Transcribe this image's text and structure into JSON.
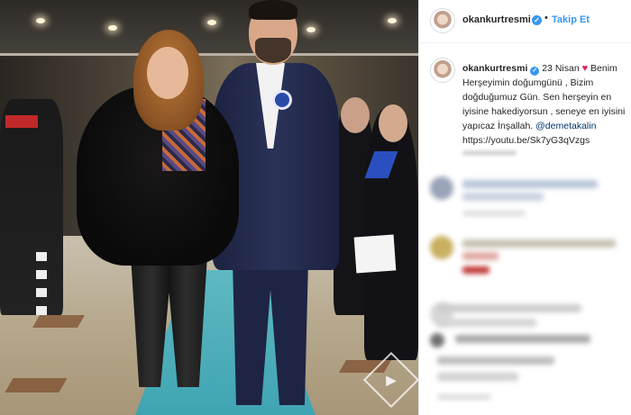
{
  "post": {
    "username": "okankurtresmi",
    "verified_glyph": "✓",
    "separator": "•",
    "follow_label": "Takip Et",
    "caption": {
      "username": "okankurtresmi",
      "date": "23 Nisan",
      "heart": "♥",
      "text_part1": "Benim Herşeyimin doğumgünü , Bizim doğduğumuz Gün. Sen herşeyin en iyisine hakediyorsun , seneye en iyisini yapıcaz İnşallah.",
      "mention": "@demetakalin",
      "link": "https://youtu.be/Sk7yG3qVzgs"
    }
  },
  "icons": {
    "verified": "verified-badge-icon",
    "heart": "heart-icon",
    "watermark": "watermark-logo-icon"
  },
  "colors": {
    "link_blue": "#3897f0",
    "mention_blue": "#003569",
    "heart_red": "#e0245e"
  }
}
